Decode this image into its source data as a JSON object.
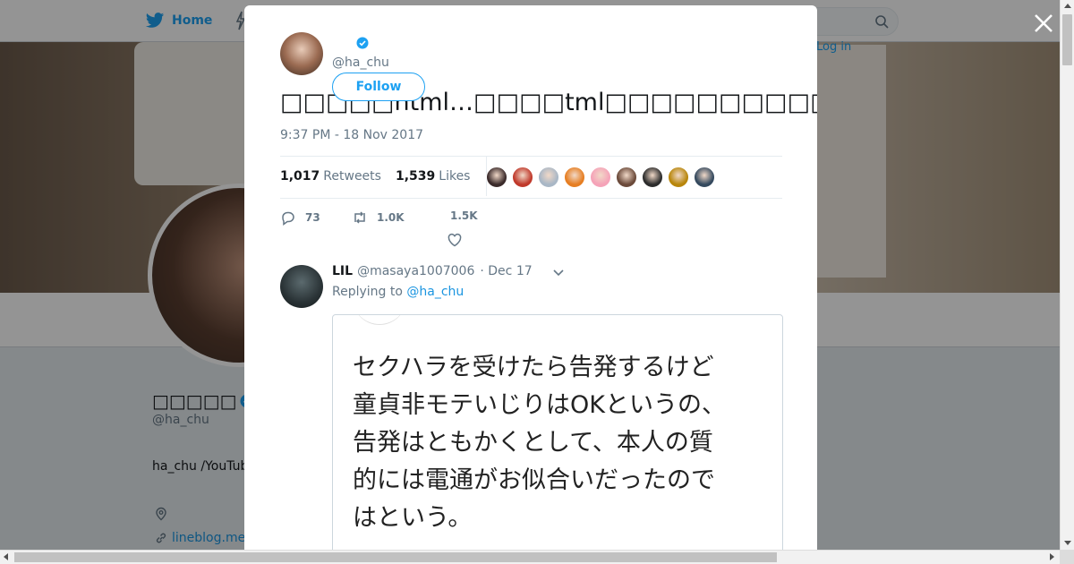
{
  "nav": {
    "home_label": "Home",
    "login_label": "Log in"
  },
  "profile_bg": {
    "name": "□□□□□",
    "handle": "@ha_chu",
    "bio": "ha_chu /YouTub",
    "link": "lineblog.me"
  },
  "tweet": {
    "handle": "@ha_chu",
    "follow_label": "Follow",
    "text": "□□□□□html…□□□□tml□□□□□□□□□□□□□□□□□□□□□□□□□□□□□□□□□□□□□□□□□□□□□□□□□□□",
    "timestamp": "9:37 PM - 18 Nov 2017",
    "retweets_count": "1,017",
    "retweets_label": "Retweets",
    "likes_count": "1,539",
    "likes_label": "Likes",
    "liker_colors": [
      "#3a2a2a",
      "#c0392b",
      "#a9b7c6",
      "#e67e22",
      "#f5a3b8",
      "#6b4a3a",
      "#2c2c2c",
      "#b8860b",
      "#34495e"
    ],
    "actions": {
      "reply_count": "73",
      "retweet_count": "1.0K",
      "like_count": "1.5K"
    }
  },
  "reply": {
    "name": "LIL",
    "handle": "@masaya1007006",
    "time": "· Dec 17",
    "replying_prefix": "Replying to",
    "replying_to": "@ha_chu",
    "image_text": [
      "セクハラを受けたら告発するけど",
      "童貞非モテいじりはOKというの、",
      "告発はともかくとして、本人の質",
      "的には電通がお似合いだったので",
      "はという。"
    ]
  },
  "colors": {
    "accent": "#1da1f2",
    "verified": "#1da1f2"
  }
}
